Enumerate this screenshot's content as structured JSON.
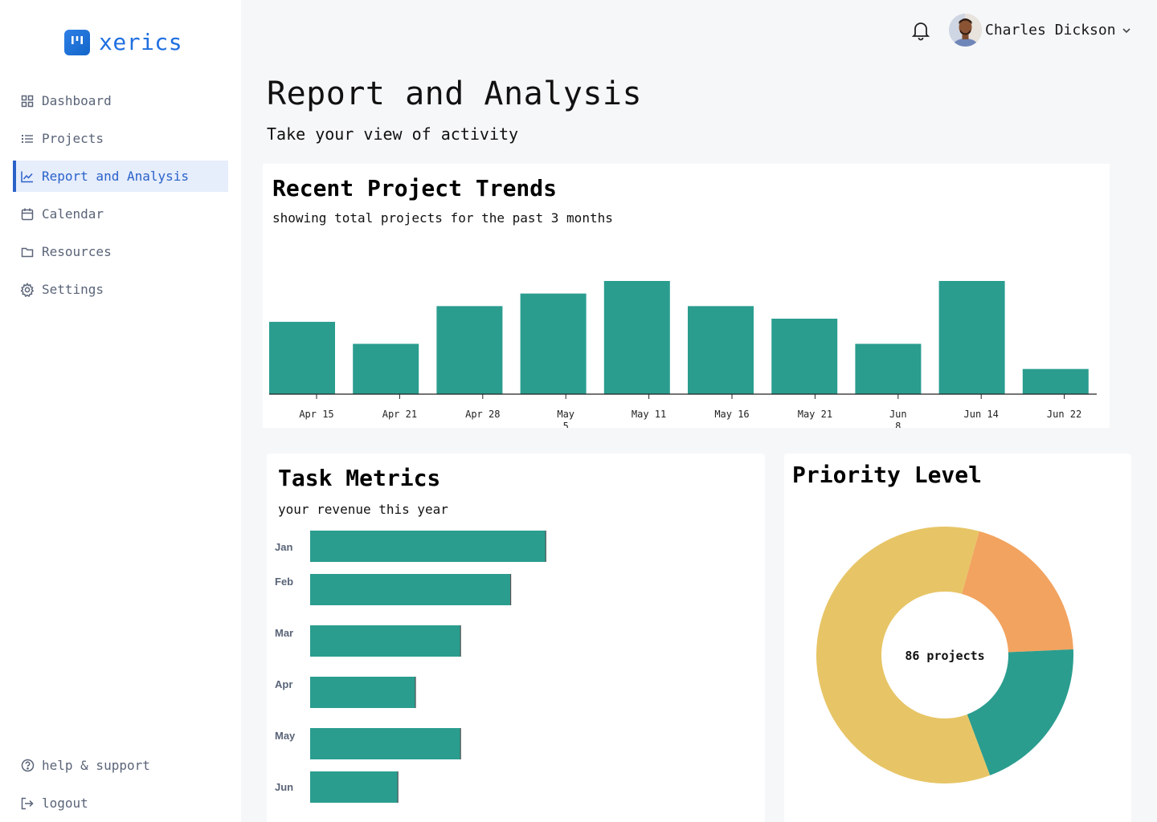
{
  "app": {
    "name": "xerics"
  },
  "sidebar": {
    "items": [
      {
        "label": "Dashboard",
        "icon": "grid-icon"
      },
      {
        "label": "Projects",
        "icon": "list-icon"
      },
      {
        "label": "Report and Analysis",
        "icon": "trend-chart-icon",
        "active": true
      },
      {
        "label": "Calendar",
        "icon": "calendar-icon"
      },
      {
        "label": "Resources",
        "icon": "folder-icon"
      },
      {
        "label": "Settings",
        "icon": "gear-icon"
      }
    ],
    "bottom": [
      {
        "label": "help & support",
        "icon": "help-icon"
      },
      {
        "label": "logout",
        "icon": "logout-icon"
      }
    ]
  },
  "header": {
    "user_name": "Charles Dickson"
  },
  "page": {
    "title": "Report and Analysis",
    "subtitle": "Take your view of activity"
  },
  "trends": {
    "title": "Recent Project Trends",
    "subtitle": "showing total projects for the past 3 months"
  },
  "tasks": {
    "title": "Task Metrics",
    "subtitle": "your revenue this year"
  },
  "priority": {
    "title": "Priority Level",
    "center_label": "86 projects"
  },
  "colors": {
    "accent": "#2a62c9",
    "teal": "#2a9d8f",
    "yellow": "#e7c566",
    "orange": "#f2a35f"
  },
  "chart_data": [
    {
      "type": "bar",
      "title": "Recent Project Trends",
      "subtitle": "showing total projects for the past 3 months",
      "categories": [
        "Apr 15",
        "Apr 21",
        "Apr 28",
        "May 5",
        "May 11",
        "May 16",
        "May 21",
        "Jun 8",
        "Jun 14",
        "Jun 22"
      ],
      "values": [
        23,
        16,
        28,
        32,
        36,
        28,
        24,
        16,
        36,
        8
      ],
      "ylim": [
        0,
        36
      ]
    },
    {
      "type": "bar",
      "orientation": "horizontal",
      "title": "Task Metrics",
      "subtitle": "your revenue this year",
      "categories": [
        "Jan",
        "Feb",
        "Mar",
        "Apr",
        "May",
        "Jun"
      ],
      "values": [
        94,
        80,
        60,
        42,
        60,
        35
      ],
      "xlim": [
        0,
        100
      ]
    },
    {
      "type": "pie",
      "title": "Priority Level",
      "center_label": "86 projects",
      "slices": [
        {
          "value": 20,
          "color": "#f2a35f"
        },
        {
          "value": 20,
          "color": "#2a9d8f"
        },
        {
          "value": 60,
          "color": "#e7c566"
        }
      ]
    }
  ]
}
